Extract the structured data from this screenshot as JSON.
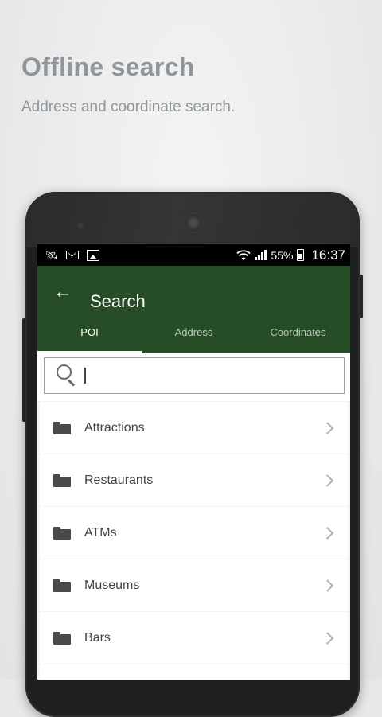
{
  "promo": {
    "title": "Offline search",
    "subtitle": "Address and coordinate search."
  },
  "statusbar": {
    "icons_left": [
      "satellite-icon",
      "mail-icon",
      "image-icon"
    ],
    "battery_pct": "55%",
    "time": "16:37"
  },
  "appbar": {
    "back_glyph": "←",
    "title": "Search"
  },
  "tabs": [
    {
      "label": "POI",
      "active": true
    },
    {
      "label": "Address",
      "active": false
    },
    {
      "label": "Coordinates",
      "active": false
    }
  ],
  "search": {
    "value": "",
    "placeholder": ""
  },
  "categories": [
    {
      "label": "Attractions"
    },
    {
      "label": "Restaurants"
    },
    {
      "label": "ATMs"
    },
    {
      "label": "Museums"
    },
    {
      "label": "Bars"
    },
    {
      "label": ""
    }
  ],
  "colors": {
    "appbar": "#264d26",
    "promo_text": "#8f959b"
  }
}
